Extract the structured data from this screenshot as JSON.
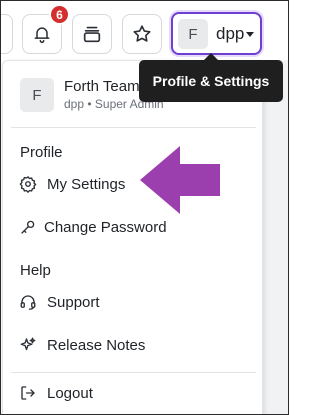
{
  "topbar": {
    "notification_count": "6",
    "profile_button": {
      "avatar_letter": "F",
      "username": "dpp"
    }
  },
  "tooltip": {
    "text": "Profile & Settings"
  },
  "menu": {
    "account": {
      "avatar_letter": "F",
      "name": "Forth Team",
      "subtitle": "dpp • Super Admin"
    },
    "profile_section": {
      "heading": "Profile",
      "items": [
        {
          "label": "My Settings",
          "icon": "gear-icon"
        },
        {
          "label": "Change Password",
          "icon": "key-icon"
        }
      ]
    },
    "help_section": {
      "heading": "Help",
      "items": [
        {
          "label": "Support",
          "icon": "headset-icon"
        },
        {
          "label": "Release Notes",
          "icon": "sparkle-icon"
        }
      ]
    },
    "logout": {
      "label": "Logout",
      "icon": "logout-icon"
    }
  },
  "annotation": {
    "arrow_color": "#9b3fae"
  },
  "colors": {
    "accent": "#6f3fd2",
    "badge": "#d32f2f",
    "tooltip_bg": "#1f1f1f"
  }
}
